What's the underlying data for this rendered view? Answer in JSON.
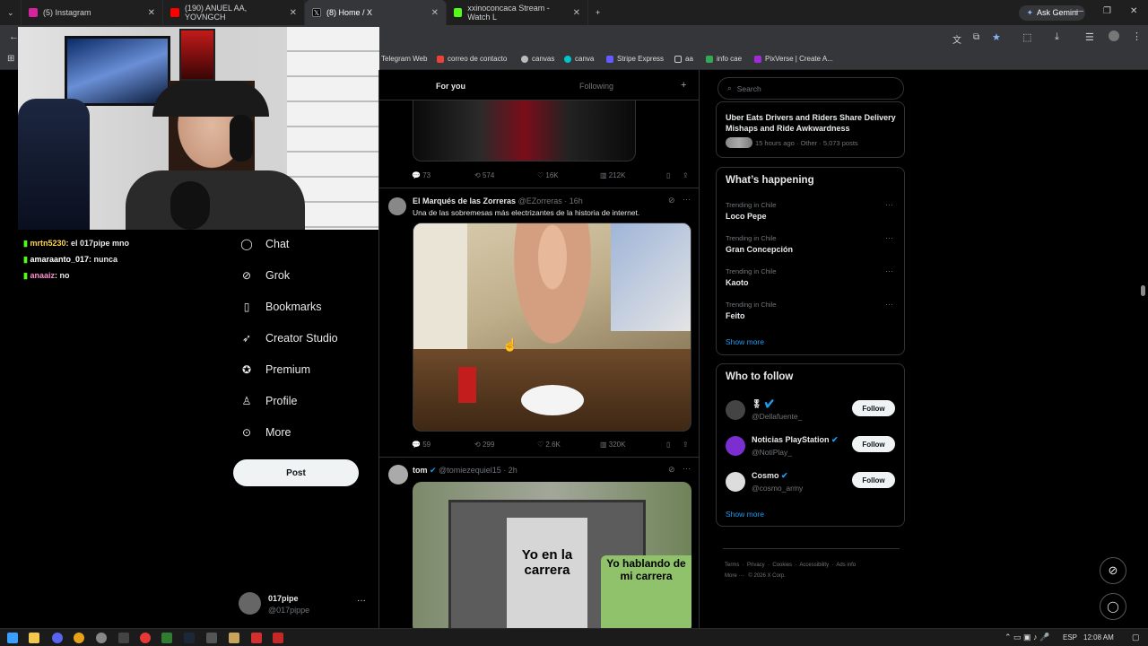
{
  "browser": {
    "tabs": [
      {
        "label": "(5) Instagram",
        "color": "#d6249f"
      },
      {
        "label": "(190) ANUEL AA, YOVNGCH",
        "color": "#ff0000"
      },
      {
        "label": "(8) Home / X",
        "color": "#000000"
      },
      {
        "label": "xxinoconcaca Stream - Watch L",
        "color": "#53fc18"
      }
    ],
    "ask_gemini": "Ask Gemini",
    "bookmarks": [
      "Telegram Web",
      "correo de contacto",
      "canvas",
      "canva",
      "Stripe Express",
      "aa",
      "info cae",
      "PixVerse | Create A..."
    ]
  },
  "chat": {
    "messages": [
      {
        "user": "mrtn5230",
        "text": ": el 017pipe mno",
        "color": "#ffd54a"
      },
      {
        "user": "amaraanto_017",
        "text": ": nunca",
        "color": "#ffffff"
      },
      {
        "user": "anaaiz",
        "text": ": no",
        "color": "#ff8fd1"
      }
    ]
  },
  "sidebar": {
    "items": [
      {
        "label": "Chat",
        "icon": "chat-icon"
      },
      {
        "label": "Grok",
        "icon": "grok-icon"
      },
      {
        "label": "Bookmarks",
        "icon": "bookmark-icon"
      },
      {
        "label": "Creator Studio",
        "icon": "rocket-icon"
      },
      {
        "label": "Premium",
        "icon": "premium-icon"
      },
      {
        "label": "Profile",
        "icon": "profile-icon"
      },
      {
        "label": "More",
        "icon": "more-icon"
      }
    ],
    "post_label": "Post",
    "account": {
      "name": "017pipe",
      "handle": "@017pippe"
    }
  },
  "feed": {
    "tabs": [
      "For you",
      "Following"
    ],
    "posts": [
      {
        "stats": {
          "replies": "73",
          "reposts": "574",
          "likes": "16K",
          "views": "212K"
        }
      },
      {
        "author": "El Marqués de las Zorreras",
        "handle": "@EZorreras",
        "time": "16h",
        "text": "Una de las sobremesas más electrizantes de la historia de internet.",
        "stats": {
          "replies": "59",
          "reposts": "299",
          "likes": "2.6K",
          "views": "320K"
        }
      },
      {
        "author": "tom",
        "handle": "@tomiezequiel15",
        "time": "2h",
        "meme_left": "Yo en la carrera",
        "meme_right": "Yo hablando de mi carrera"
      }
    ]
  },
  "right": {
    "search_placeholder": "Search",
    "top_story": {
      "title": "Uber Eats Drivers and Riders Share Delivery Mishaps and Ride Awkwardness",
      "meta": "15 hours ago · Other · 5,073 posts"
    },
    "happening_title": "What’s happening",
    "trends": [
      {
        "context": "Trending in Chile",
        "name": "Loco Pepe"
      },
      {
        "context": "Trending in Chile",
        "name": "Gran Concepción"
      },
      {
        "context": "Trending in Chile",
        "name": "Kaoto"
      },
      {
        "context": "Trending in Chile",
        "name": "Feito"
      }
    ],
    "show_more": "Show more",
    "who_title": "Who to follow",
    "follow": [
      {
        "name": "🎖",
        "handle": "@Dellafuente_"
      },
      {
        "name": "Noticias PlayStation",
        "handle": "@NotiPlay_"
      },
      {
        "name": "Cosmo",
        "handle": "@cosmo_army"
      }
    ],
    "follow_label": "Follow",
    "footer": [
      "Terms",
      "Privacy",
      "Cookies",
      "Accessibility",
      "Ads info",
      "More ···",
      "© 2026 X Corp."
    ]
  },
  "taskbar": {
    "lang": "ESP",
    "time": "12:08 AM"
  }
}
